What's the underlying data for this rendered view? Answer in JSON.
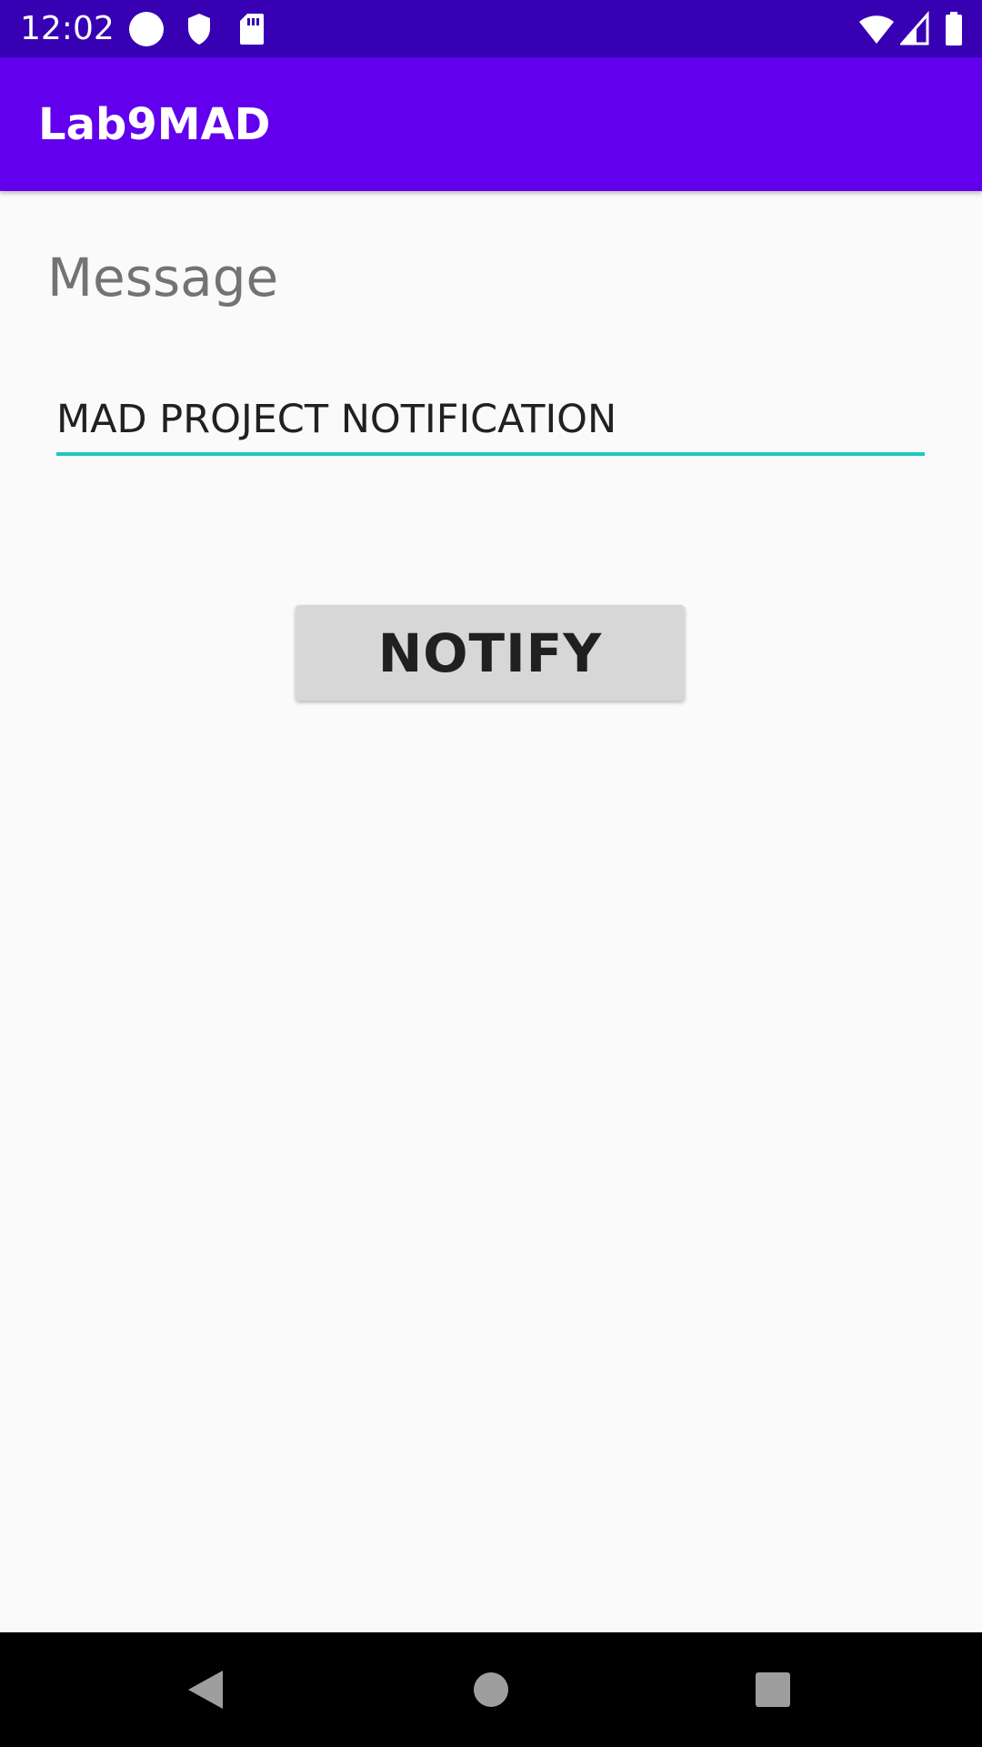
{
  "status_bar": {
    "time": "12:02",
    "icons_left": [
      "circle-icon",
      "shield-icon",
      "sd-card-icon"
    ],
    "icons_right": [
      "wifi-icon",
      "cell-signal-icon",
      "battery-icon"
    ],
    "background": "#3700b3"
  },
  "app_bar": {
    "title": "Lab9MAD",
    "background": "#6200ee"
  },
  "form": {
    "message_label": "Message",
    "message_value": "MAD PROJECT NOTIFICATION",
    "input_underline_color": "#1ec8c0",
    "notify_label": "NOTIFY"
  },
  "nav_bar": {
    "buttons": [
      "back-icon",
      "home-icon",
      "recents-icon"
    ]
  }
}
